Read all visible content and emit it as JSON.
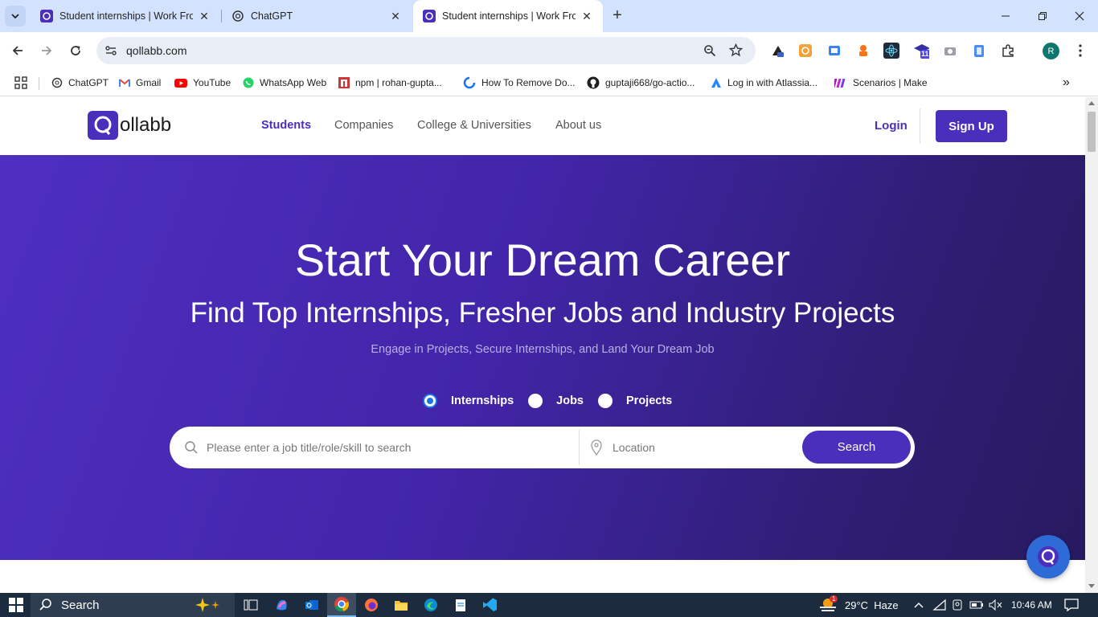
{
  "browser": {
    "tabs": [
      {
        "title": "Student internships | Work From",
        "active": false
      },
      {
        "title": "ChatGPT",
        "active": false
      },
      {
        "title": "Student internships | Work From",
        "active": true
      }
    ],
    "url": "qollabb.com",
    "bookmarks": [
      {
        "label": "ChatGPT",
        "icon": "openai-icon"
      },
      {
        "label": "Gmail",
        "icon": "gmail-icon"
      },
      {
        "label": "YouTube",
        "icon": "youtube-icon"
      },
      {
        "label": "WhatsApp Web",
        "icon": "whatsapp-icon"
      },
      {
        "label": "npm | rohan-gupta...",
        "icon": "npm-icon"
      },
      {
        "label": "How To Remove Do...",
        "icon": "globe-icon"
      },
      {
        "label": "guptaji668/go-actio...",
        "icon": "github-icon"
      },
      {
        "label": "Log in with Atlassia...",
        "icon": "atlassian-icon"
      },
      {
        "label": "Scenarios | Make",
        "icon": "make-icon"
      }
    ],
    "profile_initial": "R",
    "extension_badge": "11"
  },
  "site": {
    "logo": {
      "prefix": "Q",
      "main": "ollabb"
    },
    "nav": [
      "Students",
      "Companies",
      "College & Universities",
      "About us"
    ],
    "login": "Login",
    "signup": "Sign Up"
  },
  "hero": {
    "title": "Start Your Dream Career",
    "subtitle": "Find Top Internships, Fresher Jobs and Industry Projects",
    "tagline": "Engage in Projects, Secure Internships, and Land Your Dream Job",
    "options": [
      {
        "label": "Internships",
        "checked": true
      },
      {
        "label": "Jobs",
        "checked": false
      },
      {
        "label": "Projects",
        "checked": false
      }
    ],
    "search_placeholder": "Please enter a job title/role/skill to search",
    "location_placeholder": "Location",
    "search_button": "Search"
  },
  "taskbar": {
    "search": "Search",
    "weather": "29°C  Haze",
    "weather_badge": "1",
    "time": "10:46 AM"
  },
  "colors": {
    "brand": "#4a2fbd",
    "hero_start": "#4e2fc2",
    "hero_end": "#281a60"
  }
}
